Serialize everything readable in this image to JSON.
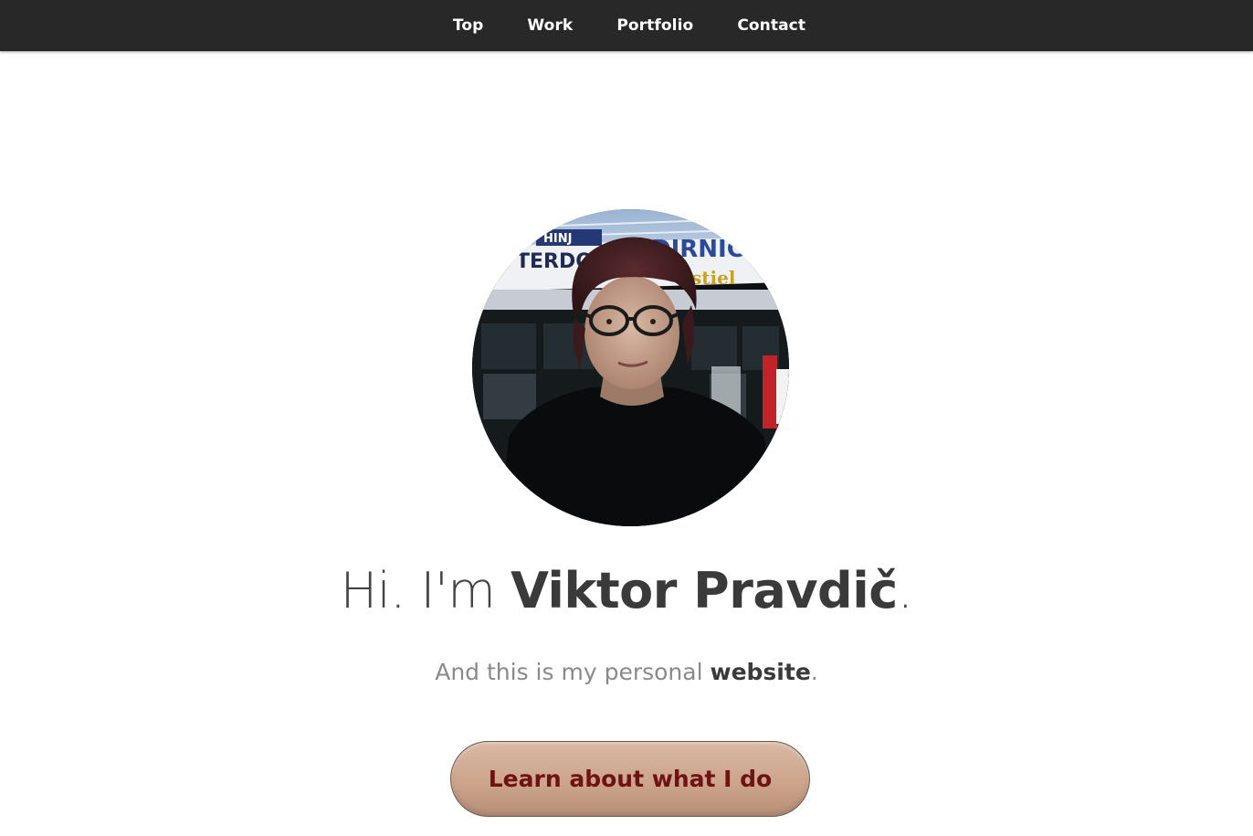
{
  "nav": {
    "items": [
      {
        "label": "Top"
      },
      {
        "label": "Work"
      },
      {
        "label": "Portfolio"
      },
      {
        "label": "Contact"
      }
    ]
  },
  "hero": {
    "avatar_icon": "profile-photo",
    "headline_prefix": "Hi. I'm ",
    "headline_name": "Viktor Pravdič",
    "headline_suffix": ".",
    "subline_prefix": "And this is my personal ",
    "subline_strong": "website",
    "subline_suffix": ".",
    "cta_label": "Learn about what I do"
  },
  "photo_sign": {
    "left_small": "HINJ",
    "left_big": "TERDO",
    "right_big": "DIRNIC",
    "right_small": "stiel"
  },
  "colors": {
    "navbar_bg": "#282828",
    "nav_text": "#ffffff",
    "headline_text": "#3a3a3a",
    "subline_text": "#8a8a8a",
    "cta_text": "#6e1212",
    "cta_bg": "#cda48c"
  }
}
